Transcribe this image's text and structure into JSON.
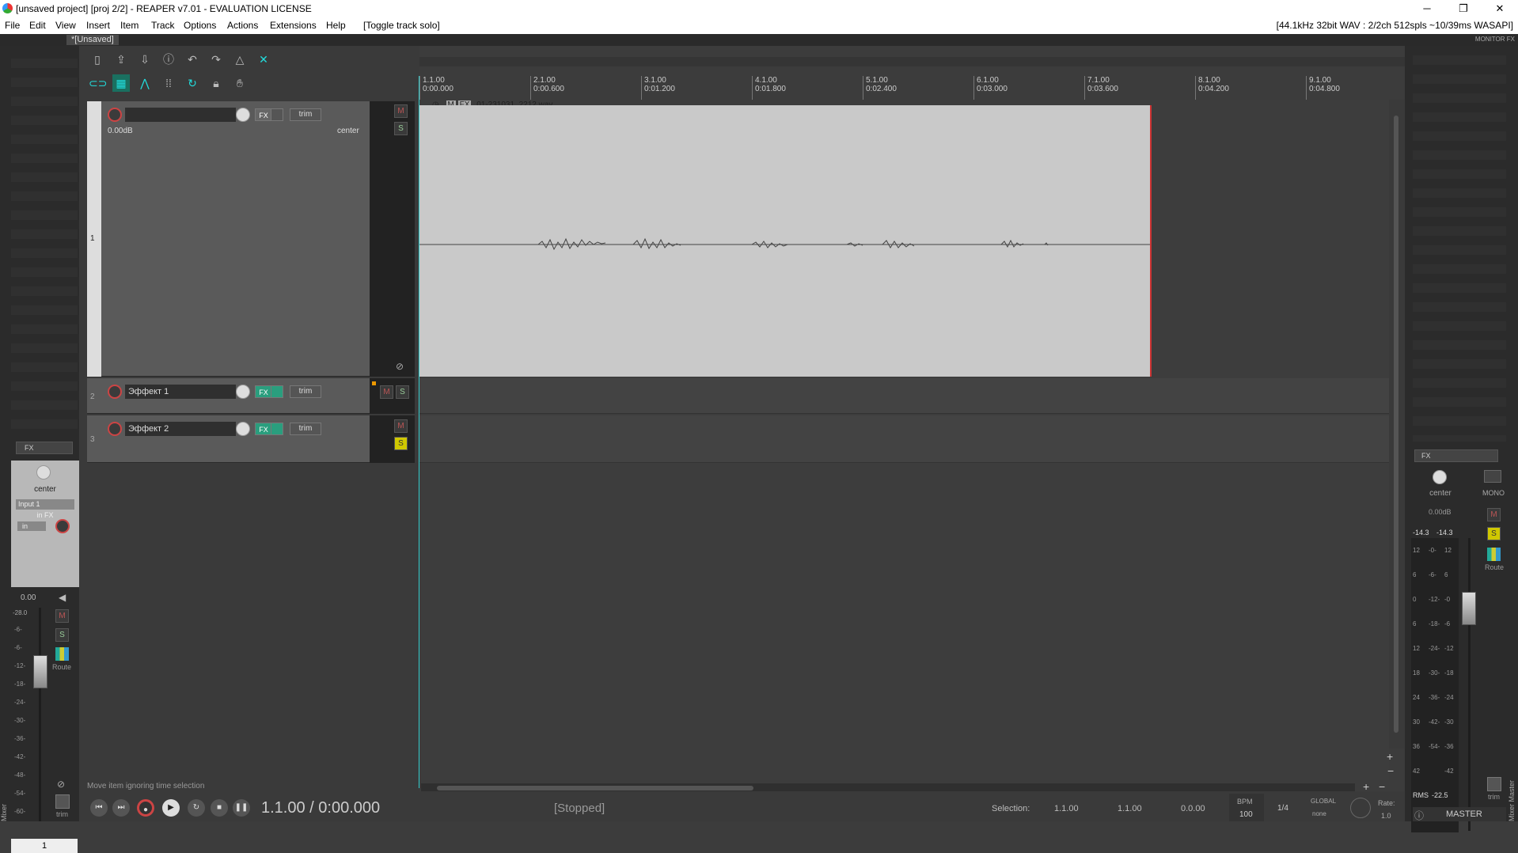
{
  "window": {
    "title": "[unsaved project] [proj 2/2] - REAPER v7.01 - EVALUATION LICENSE",
    "minimize": "─",
    "maximize": "❐",
    "close": "✕"
  },
  "menu": [
    "File",
    "Edit",
    "View",
    "Insert",
    "Item",
    "Track",
    "Options",
    "Actions",
    "Extensions",
    "Help",
    "[Toggle track solo]"
  ],
  "audio_info": "[44.1kHz 32bit WAV : 2/2ch 512spls ~10/39ms WASAPI]",
  "project_tab": "*[Unsaved]",
  "monitor_fx": "MONITOR FX",
  "ruler": [
    {
      "bar": "1.1.00",
      "time": "0:00.000"
    },
    {
      "bar": "2.1.00",
      "time": "0:00.600"
    },
    {
      "bar": "3.1.00",
      "time": "0:01.200"
    },
    {
      "bar": "4.1.00",
      "time": "0:01.800"
    },
    {
      "bar": "5.1.00",
      "time": "0:02.400"
    },
    {
      "bar": "6.1.00",
      "time": "0:03.000"
    },
    {
      "bar": "7.1.00",
      "time": "0:03.600"
    },
    {
      "bar": "8.1.00",
      "time": "0:04.200"
    },
    {
      "bar": "9.1.00",
      "time": "0:04.800"
    }
  ],
  "tracks": [
    {
      "number": "1",
      "name": "",
      "volume": "0.00dB",
      "pan": "center",
      "fx": "FX",
      "trim": "trim",
      "m": "M",
      "s": "S"
    },
    {
      "number": "2",
      "name": "Эффект 1",
      "fx": "FX",
      "trim": "trim",
      "m": "M",
      "s": "S"
    },
    {
      "number": "3",
      "name": "Эффект 2",
      "fx": "FX",
      "trim": "trim",
      "m": "M",
      "s": "S"
    }
  ],
  "item": {
    "name": "01-231031_2212.wav",
    "mute": "M",
    "fx": "FX"
  },
  "left_strip": {
    "fx": "FX",
    "pan": "center",
    "input": "Input 1",
    "infx": "in FX",
    "in": "in",
    "vol": "0.00",
    "peak": "-28.0",
    "m": "M",
    "s": "S",
    "route": "Route",
    "trim": "trim",
    "number": "1",
    "scale": [
      "-6-",
      "-6-",
      "-12-",
      "-18-",
      "-24-",
      "-30-",
      "-36-",
      "-42-",
      "-48-",
      "-54-",
      "-60-"
    ],
    "mixer": "Mixer"
  },
  "master": {
    "fx": "FX",
    "pan": "center",
    "mono": "MONO",
    "vol": "0.00dB",
    "peak_l": "-14.3",
    "peak_r": "-14.3",
    "m": "M",
    "s": "S",
    "route": "Route",
    "trim": "trim",
    "rms": "RMS",
    "rms_value": "-22.5",
    "label": "MASTER",
    "mixer": "Mixer Master",
    "scale_left": [
      "12",
      "6",
      "0",
      "6",
      "12",
      "18",
      "24",
      "30",
      "36",
      "42"
    ],
    "scale_mid": [
      "-0-",
      "-6-",
      "-12-",
      "-18-",
      "-24-",
      "-30-",
      "-36-",
      "-42-",
      "-54-"
    ],
    "scale_right": [
      "12",
      "6",
      "-0",
      "-6",
      "-12",
      "-18",
      "-24",
      "-30",
      "-36",
      "-42"
    ]
  },
  "status_hint": "Move item ignoring time selection",
  "transport": {
    "position": "1.1.00 / 0:00.000",
    "state": "[Stopped]",
    "selection_label": "Selection:",
    "sel_start": "1.1.00",
    "sel_end": "1.1.00",
    "sel_len": "0.0.00",
    "bpm_label": "BPM",
    "bpm": "100",
    "timesig": "1/4",
    "global": "GLOBAL",
    "global_mode": "none",
    "rate_label": "Rate:",
    "rate": "1.0"
  },
  "colors": {
    "accent": "#2a9e7e",
    "solo": "#d0c800",
    "record": "#c44",
    "item_end": "#c33"
  }
}
